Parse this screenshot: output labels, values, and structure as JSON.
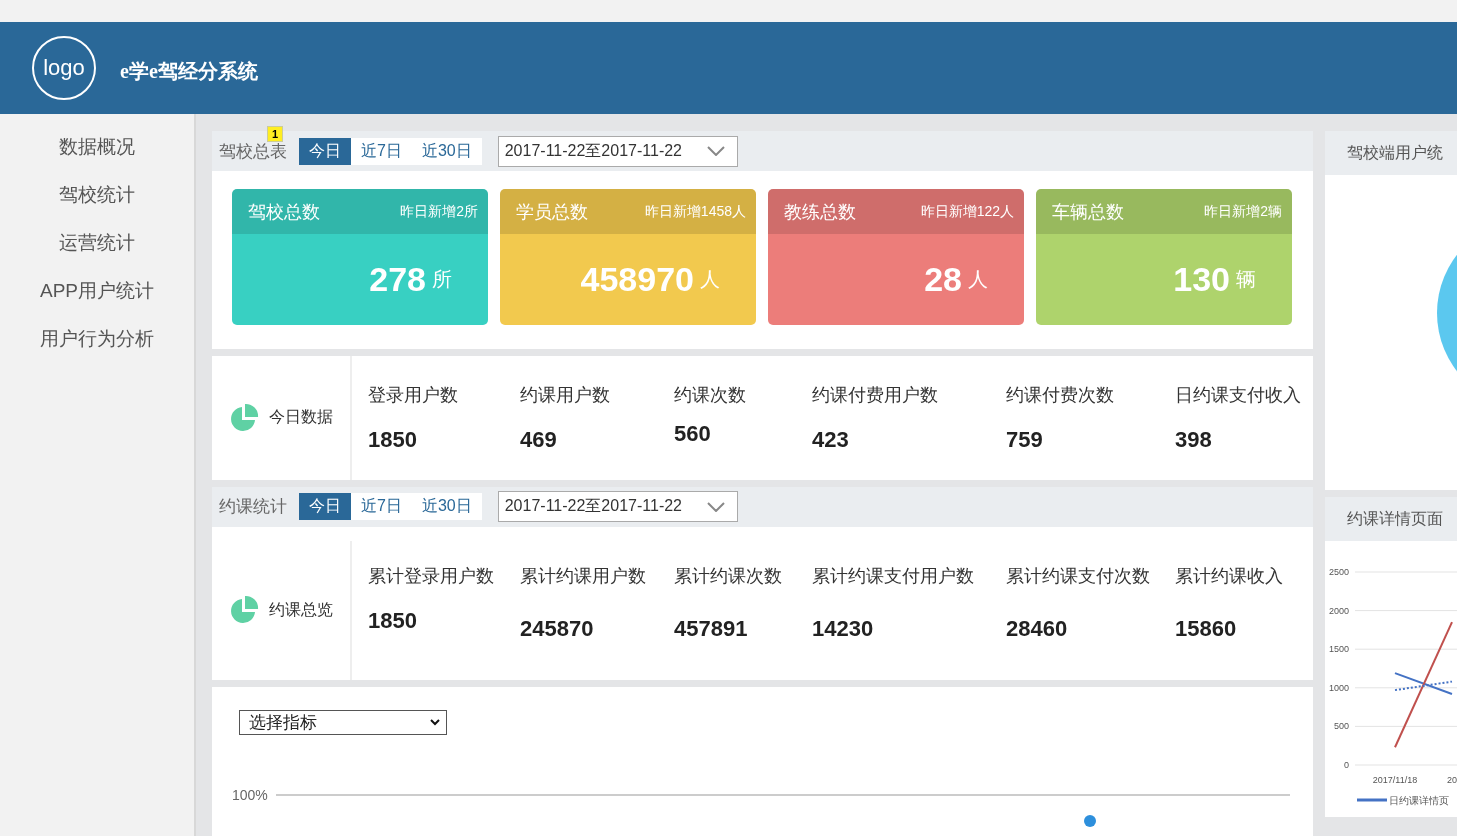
{
  "header": {
    "logo": "logo",
    "title": "e学e驾经分系统"
  },
  "sidebar": {
    "items": [
      {
        "label": "数据概况",
        "selected": false
      },
      {
        "label": "驾校统计",
        "selected": false
      },
      {
        "label": "运营统计",
        "selected": false
      },
      {
        "label": "APP用户统计",
        "selected": false
      },
      {
        "label": "用户行为分析",
        "selected": false
      }
    ]
  },
  "school_panel": {
    "title": "驾校总表",
    "badge": "1",
    "tabs": [
      {
        "label": "今日",
        "selected": true
      },
      {
        "label": "近7日",
        "selected": false
      },
      {
        "label": "近30日",
        "selected": false
      }
    ],
    "date_range": "2017-11-22至2017-11-22",
    "cards": [
      {
        "title": "驾校总数",
        "note": "昨日新增2所",
        "value": "278",
        "unit": "所",
        "color": "#38d0c2"
      },
      {
        "title": "学员总数",
        "note": "昨日新增1458人",
        "value": "458970",
        "unit": "人",
        "color": "#f2c94e"
      },
      {
        "title": "教练总数",
        "note": "昨日新增122人",
        "value": "28",
        "unit": "人",
        "color": "#ec7d7a"
      },
      {
        "title": "车辆总数",
        "note": "昨日新增2辆",
        "value": "130",
        "unit": "辆",
        "color": "#aed36c"
      }
    ]
  },
  "today_data": {
    "label": "今日数据",
    "metrics": [
      {
        "label": "登录用户数",
        "value": "1850"
      },
      {
        "label": "约课用户数",
        "value": "469"
      },
      {
        "label": "约课次数",
        "value": "560"
      },
      {
        "label": "约课付费用户数",
        "value": "423"
      },
      {
        "label": "约课付费次数",
        "value": "759"
      },
      {
        "label": "日约课支付收入",
        "value": "398"
      }
    ]
  },
  "booking_panel": {
    "title": "约课统计",
    "tabs": [
      {
        "label": "今日",
        "selected": true
      },
      {
        "label": "近7日",
        "selected": false
      },
      {
        "label": "近30日",
        "selected": false
      }
    ],
    "date_range": "2017-11-22至2017-11-22",
    "overview_label": "约课总览",
    "metrics": [
      {
        "label": "累计登录用户数",
        "value": "1850"
      },
      {
        "label": "累计约课用户数",
        "value": "245870"
      },
      {
        "label": "累计约课次数",
        "value": "457891"
      },
      {
        "label": "累计约课支付用户数",
        "value": "14230"
      },
      {
        "label": "累计约课支付次数",
        "value": "28460"
      },
      {
        "label": "累计约课收入",
        "value": "15860"
      }
    ]
  },
  "indicator_panel": {
    "select": "选择指标",
    "axis_label": "100%"
  },
  "right_panels": [
    {
      "title": "驾校端用户统"
    },
    {
      "title": "约课详情页面",
      "chart_data": {
        "type": "line",
        "grid": true,
        "categories": [
          "2017/11/18",
          "20"
        ],
        "yticks": [
          0,
          500,
          1000,
          1500,
          2000,
          2500
        ],
        "ylim": [
          0,
          2500
        ],
        "series": [
          {
            "name": "日约课详情页",
            "color": "#4472c4",
            "line_style": "solid",
            "values": [
              1190,
              920
            ]
          },
          {
            "color": "#c0504d",
            "line_style": "solid",
            "values": [
              230,
              1850
            ]
          },
          {
            "color": "#4472c4",
            "line_style": "dotted",
            "values": [
              970,
              1080
            ]
          }
        ]
      }
    }
  ]
}
